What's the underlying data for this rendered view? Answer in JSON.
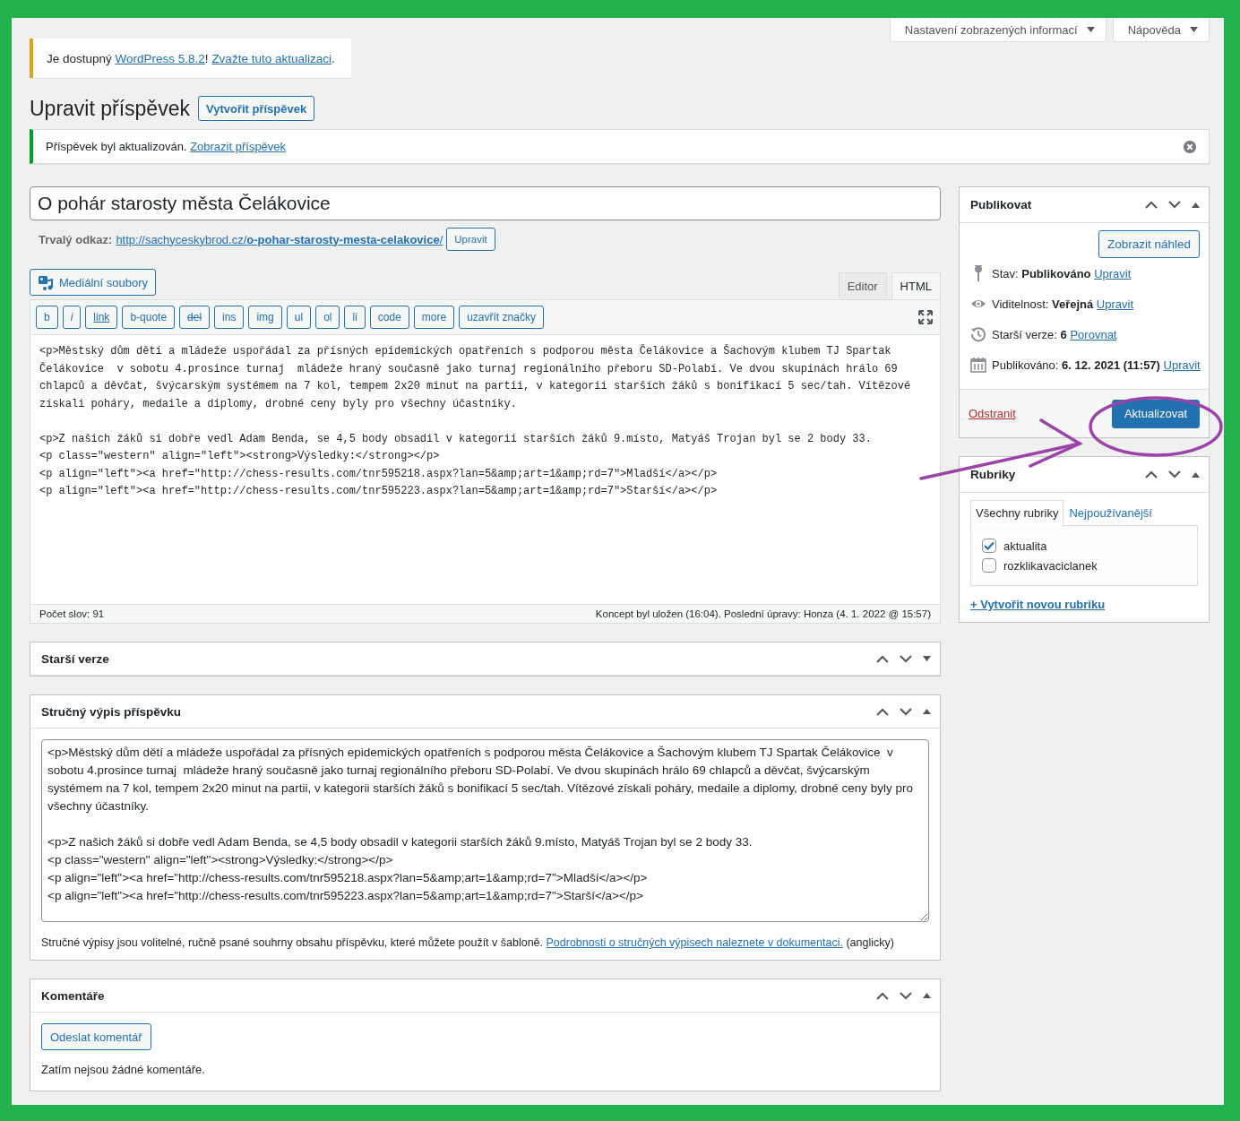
{
  "screen_options": [
    {
      "label": "Nastavení zobrazených informací"
    },
    {
      "label": "Nápověda"
    }
  ],
  "update_notice": [
    {
      "text": "Je dostupný "
    },
    {
      "link": "WordPress 5.8.2"
    },
    {
      "text": "! "
    },
    {
      "link": "Zvažte tuto aktualizaci"
    },
    {
      "text": "."
    }
  ],
  "page_title": "Upravit příspěvek",
  "add_new_button": "Vytvořit příspěvek",
  "success_notice": [
    {
      "text": "Příspěvek byl aktualizován. "
    },
    {
      "link": "Zobrazit příspěvek"
    }
  ],
  "post_title": "O pohár starosty města Čelákovice",
  "permalink": {
    "label": "Trvalý odkaz:",
    "url": "http://sachyceskybrod.cz/**o-pohar-starosty-mesta-celakovice**/",
    "edit_button": "Upravit"
  },
  "media_button": "Mediální soubory",
  "editor_tabs": [
    {
      "label": "Editor",
      "selected": false
    },
    {
      "label": "HTML",
      "selected": true
    }
  ],
  "quicktags": [
    {
      "label": "b",
      "kind": "plain"
    },
    {
      "label": "i",
      "kind": "italic"
    },
    {
      "label": "link",
      "kind": "underline"
    },
    {
      "label": "b-quote",
      "kind": "plain"
    },
    {
      "label": "del",
      "kind": "strike"
    },
    {
      "label": "ins",
      "kind": "plain"
    },
    {
      "label": "img",
      "kind": "plain"
    },
    {
      "label": "ul",
      "kind": "plain"
    },
    {
      "label": "ol",
      "kind": "plain"
    },
    {
      "label": "li",
      "kind": "plain"
    },
    {
      "label": "code",
      "kind": "plain"
    },
    {
      "label": "more",
      "kind": "plain"
    },
    {
      "label": "uzavřít značky",
      "kind": "plain"
    }
  ],
  "content": "<p>Městský dům dětí a mládeže uspořádal za přísných epidemických opatřeních s podporou města Čelákovice a Šachovým klubem TJ Spartak Čelákovice  v sobotu 4.prosince turnaj  mládeže hraný současně jako turnaj regionálního přeboru SD-Polabí. Ve dvou skupinách hrálo 69 chlapců a děvčat, švýcarským systémem na 7 kol, tempem 2x20 minut na partii, v kategorii starších žáků s bonifikací 5 sec/tah. Vítězové získali poháry, medaile a diplomy, drobné ceny byly pro všechny účastníky.\n\n<p>Z našich žáků si dobře vedl Adam Benda, se 4,5 body obsadil v kategorii starších žáků 9.místo, Matyáš Trojan byl se 2 body 33.\n<p class=\"western\" align=\"left\"><strong>Výsledky:</strong></p>\n<p align=\"left\"><a href=\"http://chess-results.com/tnr595218.aspx?lan=5&amp;art=1&amp;rd=7\">Mladší</a></p>\n<p align=\"left\"><a href=\"http://chess-results.com/tnr595223.aspx?lan=5&amp;art=1&amp;rd=7\">Starší</a></p>",
  "status_bar": {
    "word_count": "Počet slov: 91",
    "autosave": "Koncept byl uložen (16:04). Poslední úpravy: Honza (4. 1. 2022 @ 15:57)"
  },
  "revisions_box": {
    "title": "Starší verze",
    "expanded": false
  },
  "excerpt_box": {
    "title": "Stručný výpis příspěvku",
    "expanded": true,
    "text": "<p>Městský dům dětí a mládeže uspořádal za přísných epidemických opatřeních s podporou města Čelákovice a Šachovým klubem TJ Spartak Čelákovice  v sobotu 4.prosince turnaj  mládeže hraný současně jako turnaj regionálního přeboru SD-Polabí. Ve dvou skupinách hrálo 69 chlapců a děvčat, švýcarským systémem na 7 kol, tempem 2x20 minut na partii, v kategorii starších žáků s bonifikací 5 sec/tah. Vítězové získali poháry, medaile a diplomy, drobné ceny byly pro všechny účastníky.\n\n<p>Z našich žáků si dobře vedl Adam Benda, se 4,5 body obsadil v kategorii starších žáků 9.místo, Matyáš Trojan byl se 2 body 33.\n<p class=\"western\" align=\"left\"><strong>Výsledky:</strong></p>\n<p align=\"left\"><a href=\"http://chess-results.com/tnr595218.aspx?lan=5&amp;art=1&amp;rd=7\">Mladší</a></p>\n<p align=\"left\"><a href=\"http://chess-results.com/tnr595223.aspx?lan=5&amp;art=1&amp;rd=7\">Starší</a></p>",
    "note": [
      {
        "text": "Stručné výpisy jsou volitelné, ručně psané souhrny obsahu příspěvku, které můžete použít v šabloně. "
      },
      {
        "link": "Podrobnosti o stručných výpisech naleznete v dokumentaci."
      },
      {
        "text": " (anglicky)"
      }
    ]
  },
  "comments_box": {
    "title": "Komentáře",
    "expanded": true,
    "button": "Odeslat komentář",
    "empty_text": "Zatím nejsou žádné komentáře."
  },
  "publish_box": {
    "title": "Publikovat",
    "expanded": true,
    "preview_button": "Zobrazit náhled",
    "rows": [
      {
        "kind": "status",
        "label": "Stav:",
        "value": "Publikováno",
        "link": "Upravit"
      },
      {
        "kind": "visibility",
        "label": "Viditelnost:",
        "value": "Veřejná",
        "link": "Upravit"
      },
      {
        "kind": "revisions",
        "label": "Starší verze:",
        "value": "6",
        "link": "Porovnat"
      },
      {
        "kind": "date",
        "label": "Publikováno:",
        "value": "6. 12. 2021 (11:57)",
        "link": "Upravit"
      }
    ],
    "delete_link": "Odstranit",
    "update_button": "Aktualizovat"
  },
  "categories_box": {
    "title": "Rubriky",
    "expanded": true,
    "tabs": [
      {
        "label": "Všechny rubriky",
        "selected": true
      },
      {
        "label": "Nejpoužívanější",
        "selected": false
      }
    ],
    "items": [
      {
        "label": "aktualita",
        "checked": true
      },
      {
        "label": "rozklikavaciclanek",
        "checked": false
      }
    ],
    "add_link": "+ Vytvořit novou rubriku"
  }
}
